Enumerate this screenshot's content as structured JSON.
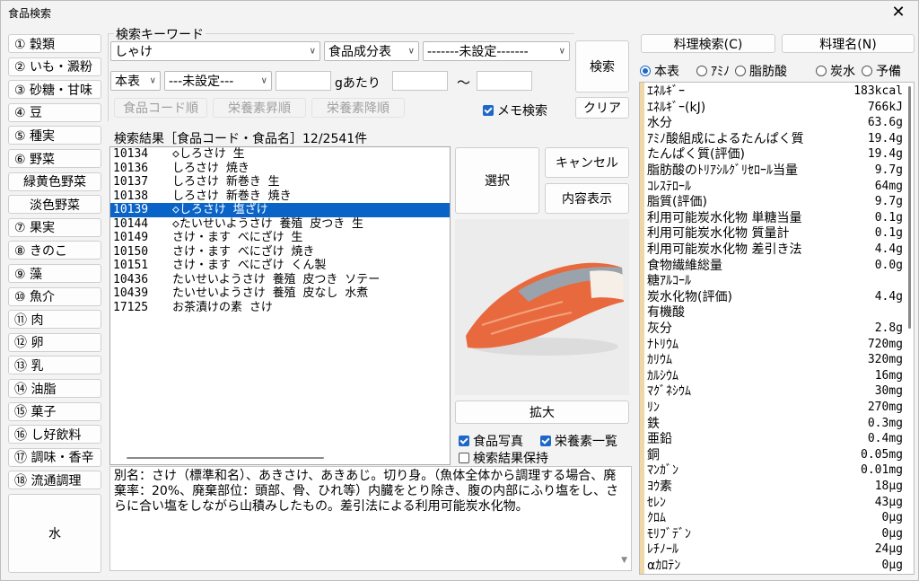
{
  "window": {
    "title": "食品検索",
    "close_glyph": "✕"
  },
  "categories": [
    "① 穀類",
    "② いも・澱粉",
    "③ 砂糖・甘味",
    "④ 豆",
    "⑤ 種実",
    "⑥ 野菜",
    "緑黄色野菜",
    "淡色野菜",
    "⑦ 果実",
    "⑧ きのこ",
    "⑨ 藻",
    "⑩ 魚介",
    "⑪ 肉",
    "⑫ 卵",
    "⑬ 乳",
    "⑭ 油脂",
    "⑮ 菓子",
    "⑯ し好飲料",
    "⑰ 調味・香辛",
    "⑱ 流通調理"
  ],
  "water_button": "水",
  "search": {
    "group_label": "検索キーワード",
    "keyword": "しゃけ",
    "table_select": "食品成分表",
    "filter1": "-------未設定-------",
    "table2_select": "本表",
    "filter2": "---未設定---",
    "per_unit": "gあたり",
    "range_sep": "〜",
    "search_button": "検索",
    "clear_button": "クリア",
    "sort_code": "食品コード順",
    "sort_asc": "栄養素昇順",
    "sort_desc": "栄養素降順",
    "memo_search": "メモ検索"
  },
  "results": {
    "header": "検索結果［食品コード・食品名］12/2541件",
    "rows": [
      {
        "code": "10134",
        "name": "◇しろさけ 生"
      },
      {
        "code": "10136",
        "name": "しろさけ 焼き"
      },
      {
        "code": "10137",
        "name": "しろさけ 新巻き 生"
      },
      {
        "code": "10138",
        "name": "しろさけ 新巻き 焼き"
      },
      {
        "code": "10139",
        "name": "◇しろさけ 塩ざけ"
      },
      {
        "code": "10144",
        "name": "◇たいせいようさけ 養殖 皮つき 生"
      },
      {
        "code": "10149",
        "name": "さけ・ます べにざけ 生"
      },
      {
        "code": "10150",
        "name": "さけ・ます べにざけ 焼き"
      },
      {
        "code": "10151",
        "name": "さけ・ます べにざけ くん製"
      },
      {
        "code": "10436",
        "name": "たいせいようさけ 養殖 皮つき ソテー"
      },
      {
        "code": "10439",
        "name": "たいせいようさけ 養殖 皮なし 水煮"
      },
      {
        "code": "17125",
        "name": "お茶漬けの素 さけ"
      }
    ]
  },
  "actions": {
    "select": "選択",
    "cancel": "キャンセル",
    "show_content": "内容表示",
    "enlarge": "拡大",
    "food_photo": "食品写真",
    "nutrient_list": "栄養素一覧",
    "keep_results": "検索結果保持"
  },
  "description": "別名：さけ（標準和名）、あきさけ、あきあじ。切り身。（魚体全体から調理する場合、廃棄率：20%、廃棄部位：頭部、骨、ひれ等）内臓をとり除き、腹の内部にふり塩をし、さらに合い塩をしながら山積みしたもの。差引法による利用可能炭水化物。",
  "right_buttons": {
    "recipe_search": "料理検索(C)",
    "recipe_name": "料理名(N)"
  },
  "nutrient_tabs": [
    "本表",
    "ｱﾐﾉ",
    "脂肪酸",
    "炭水",
    "予備"
  ],
  "nutrients": [
    {
      "name": "ｴﾈﾙｷﾞｰ",
      "value": "183kcal"
    },
    {
      "name": "ｴﾈﾙｷﾞｰ(kJ)",
      "value": "766kJ"
    },
    {
      "name": "水分",
      "value": "63.6g"
    },
    {
      "name": "ｱﾐﾉ酸組成によるたんぱく質",
      "value": "19.4g"
    },
    {
      "name": "たんぱく質(評価)",
      "value": "19.4g"
    },
    {
      "name": "脂肪酸のﾄﾘｱｼﾙｸﾞﾘｾﾛｰﾙ当量",
      "value": "9.7g"
    },
    {
      "name": "ｺﾚｽﾃﾛｰﾙ",
      "value": "64mg"
    },
    {
      "name": "脂質(評価)",
      "value": "9.7g"
    },
    {
      "name": "利用可能炭水化物 単糖当量",
      "value": "0.1g"
    },
    {
      "name": "利用可能炭水化物 質量計",
      "value": "0.1g"
    },
    {
      "name": "利用可能炭水化物 差引き法",
      "value": "4.4g"
    },
    {
      "name": "食物繊維総量",
      "value": "0.0g"
    },
    {
      "name": "糖ｱﾙｺｰﾙ",
      "value": ""
    },
    {
      "name": "炭水化物(評価)",
      "value": "4.4g"
    },
    {
      "name": "有機酸",
      "value": ""
    },
    {
      "name": "灰分",
      "value": "2.8g"
    },
    {
      "name": "ﾅﾄﾘｳﾑ",
      "value": "720mg"
    },
    {
      "name": "ｶﾘｳﾑ",
      "value": "320mg"
    },
    {
      "name": "ｶﾙｼｳﾑ",
      "value": "16mg"
    },
    {
      "name": "ﾏｸﾞﾈｼｳﾑ",
      "value": "30mg"
    },
    {
      "name": "ﾘﾝ",
      "value": "270mg"
    },
    {
      "name": "鉄",
      "value": "0.3mg"
    },
    {
      "name": "亜鉛",
      "value": "0.4mg"
    },
    {
      "name": "銅",
      "value": "0.05mg"
    },
    {
      "name": "ﾏﾝｶﾞﾝ",
      "value": "0.01mg"
    },
    {
      "name": "ﾖｳ素",
      "value": "18μg"
    },
    {
      "name": "ｾﾚﾝ",
      "value": "43μg"
    },
    {
      "name": "ｸﾛﾑ",
      "value": "0μg"
    },
    {
      "name": "ﾓﾘﾌﾞﾃﾞﾝ",
      "value": "0μg"
    },
    {
      "name": "ﾚﾁﾉｰﾙ",
      "value": "24μg"
    },
    {
      "name": "αｶﾛﾃﾝ",
      "value": "0μg"
    }
  ],
  "colors": {
    "selection": "#0a64c8",
    "accent": "#1e67c9",
    "nutrient_bar": "#f0d7a6",
    "salmon": "#e8693d"
  }
}
